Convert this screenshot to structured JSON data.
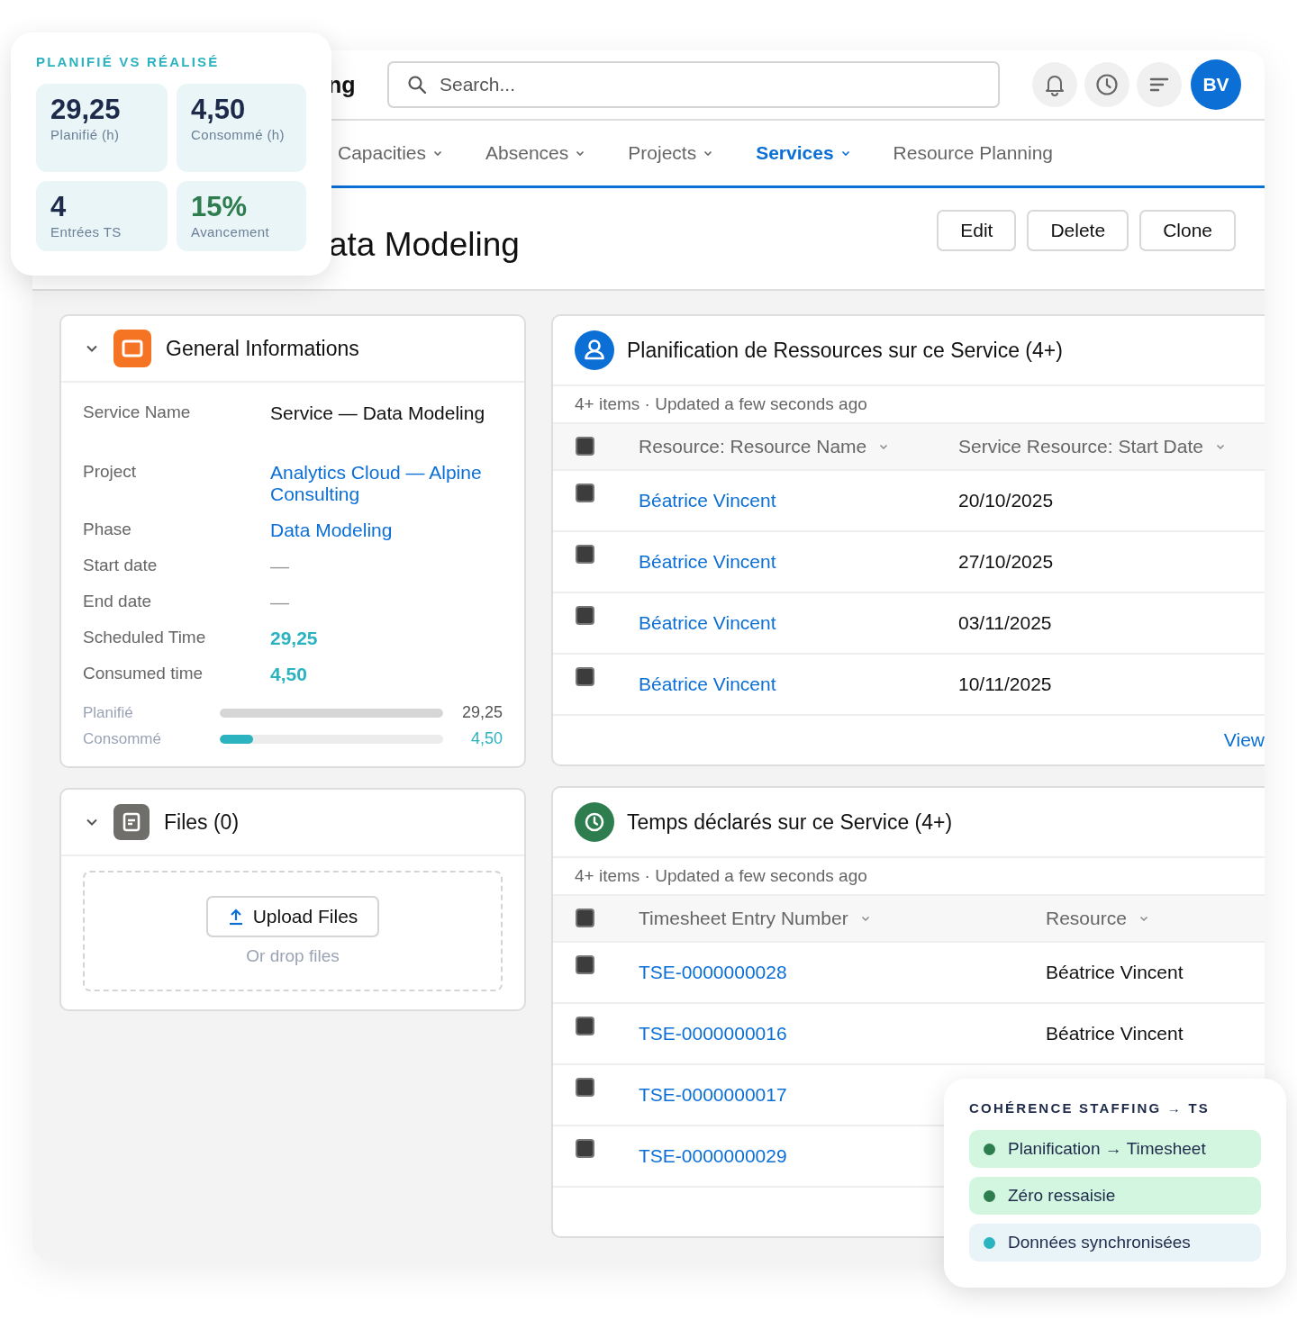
{
  "stats_card": {
    "title": "PLANIFIÉ VS RÉALISÉ",
    "tiles": [
      {
        "value": "29,25",
        "label": "Planifié (h)",
        "highlight": false
      },
      {
        "value": "4,50",
        "label": "Consommé (h)",
        "highlight": false
      },
      {
        "value": "4",
        "label": "Entrées TS",
        "highlight": false
      },
      {
        "value": "15%",
        "label": "Avancement",
        "highlight": true
      }
    ]
  },
  "header": {
    "app_title": "ng",
    "search": {
      "placeholder": "Search..."
    },
    "avatar": "BV"
  },
  "nav": [
    {
      "label": "Capacities",
      "has_menu": true,
      "selected": false
    },
    {
      "label": "Absences",
      "has_menu": true,
      "selected": false
    },
    {
      "label": "Projects",
      "has_menu": true,
      "selected": false
    },
    {
      "label": "Services",
      "has_menu": true,
      "selected": true
    },
    {
      "label": "Resource Planning",
      "has_menu": false,
      "selected": false
    }
  ],
  "record": {
    "title": "ata Modeling",
    "actions": [
      "Edit",
      "Delete",
      "Clone"
    ]
  },
  "general": {
    "title": "General Informations",
    "expanded": true,
    "fields": [
      {
        "label": "Service Name",
        "value": "Service — Data Modeling",
        "kind": "text"
      },
      {
        "label": "Project",
        "value": "Analytics Cloud — Alpine Consulting",
        "kind": "link"
      },
      {
        "label": "Phase",
        "value": "Data Modeling",
        "kind": "link"
      },
      {
        "label": "Start date",
        "value": "—",
        "kind": "empty"
      },
      {
        "label": "End date",
        "value": "—",
        "kind": "empty"
      },
      {
        "label": "Scheduled Time",
        "value": "29,25",
        "kind": "metric"
      },
      {
        "label": "Consumed time",
        "value": "4,50",
        "kind": "metric"
      }
    ],
    "bars": [
      {
        "label": "Planifié",
        "level": 1,
        "reading": "29,25",
        "kind": "planned"
      },
      {
        "label": "Consommé",
        "level": 0.15,
        "reading": "4,50",
        "kind": "consumed"
      }
    ]
  },
  "files": {
    "title": "Files (0)",
    "expanded": true,
    "upload": "Upload Files",
    "hint": "Or drop files"
  },
  "related": [
    {
      "kind": "planning",
      "title": "Planification de Ressources sur ce Service (4+)",
      "meta": "4+ items · Updated a few seconds ago",
      "columns": [
        {
          "label": "Resource: Resource Name",
          "kind": "link"
        },
        {
          "label": "Service Resource: Start Date",
          "kind": "text"
        }
      ],
      "all_checked": false,
      "rows": [
        {
          "cells": [
            "Béatrice Vincent",
            "20/10/2025"
          ],
          "checked": false
        },
        {
          "cells": [
            "Béatrice Vincent",
            "27/10/2025"
          ],
          "checked": false
        },
        {
          "cells": [
            "Béatrice Vincent",
            "03/11/2025"
          ],
          "checked": false
        },
        {
          "cells": [
            "Béatrice Vincent",
            "10/11/2025"
          ],
          "checked": false
        }
      ],
      "footer": "View"
    },
    {
      "kind": "timesheet",
      "title": "Temps déclarés sur ce Service (4+)",
      "meta": "4+ items · Updated a few seconds ago",
      "columns": [
        {
          "label": "Timesheet Entry Number",
          "kind": "link"
        },
        {
          "label": "Resource",
          "kind": "text"
        }
      ],
      "all_checked": false,
      "rows": [
        {
          "cells": [
            "TSE-0000000028",
            "Béatrice Vincent"
          ],
          "checked": false
        },
        {
          "cells": [
            "TSE-0000000016",
            "Béatrice Vincent"
          ],
          "checked": false
        },
        {
          "cells": [
            "TSE-0000000017"
          ],
          "checked": false
        },
        {
          "cells": [
            "TSE-0000000029"
          ],
          "checked": false
        }
      ]
    }
  ],
  "coherence_card": {
    "title": "COHÉRENCE STAFFING → TS",
    "items": [
      {
        "label": "Planification → Timesheet",
        "color": "#2e7d4f",
        "kind": "ok"
      },
      {
        "label": "Zéro ressaisie",
        "color": "#2e7d4f",
        "kind": "ok"
      },
      {
        "label": "Données synchronisées",
        "color": "#2bb3c0",
        "kind": "info"
      }
    ]
  }
}
